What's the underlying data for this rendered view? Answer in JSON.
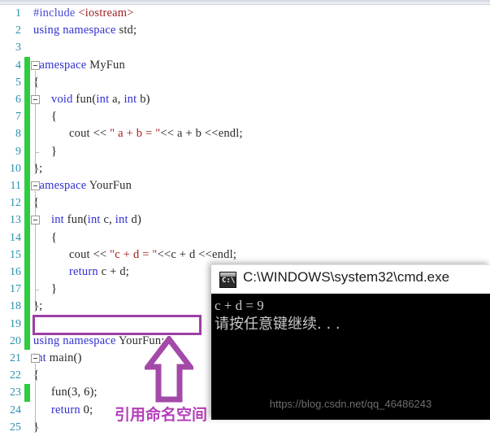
{
  "editor": {
    "first_line": 1,
    "lines": [
      {
        "n": 1,
        "changed": false,
        "indent": 0,
        "text": "#include <iostream>"
      },
      {
        "n": 2,
        "changed": false,
        "indent": 0,
        "text": "using namespace std;"
      },
      {
        "n": 3,
        "changed": false,
        "indent": 0,
        "text": ""
      },
      {
        "n": 4,
        "changed": true,
        "indent": 0,
        "text": "namespace MyFun"
      },
      {
        "n": 5,
        "changed": true,
        "indent": 0,
        "text": "{"
      },
      {
        "n": 6,
        "changed": true,
        "indent": 1,
        "text": "void  fun(int a,  int b)"
      },
      {
        "n": 7,
        "changed": true,
        "indent": 1,
        "text": "{"
      },
      {
        "n": 8,
        "changed": true,
        "indent": 2,
        "text": "cout << \" a + b = \"<< a + b <<endl;"
      },
      {
        "n": 9,
        "changed": true,
        "indent": 1,
        "text": "}"
      },
      {
        "n": 10,
        "changed": true,
        "indent": 0,
        "text": "};"
      },
      {
        "n": 11,
        "changed": true,
        "indent": 0,
        "text": "namespace YourFun"
      },
      {
        "n": 12,
        "changed": true,
        "indent": 0,
        "text": "{"
      },
      {
        "n": 13,
        "changed": true,
        "indent": 1,
        "text": "int fun(int c,  int d)"
      },
      {
        "n": 14,
        "changed": true,
        "indent": 1,
        "text": "{"
      },
      {
        "n": 15,
        "changed": true,
        "indent": 2,
        "text": "cout << \"c + d = \"<<c + d <<endl;"
      },
      {
        "n": 16,
        "changed": true,
        "indent": 2,
        "text": "return  c + d;"
      },
      {
        "n": 17,
        "changed": true,
        "indent": 1,
        "text": "}"
      },
      {
        "n": 18,
        "changed": true,
        "indent": 0,
        "text": "};"
      },
      {
        "n": 19,
        "changed": true,
        "indent": 0,
        "text": ""
      },
      {
        "n": 20,
        "changed": true,
        "indent": 0,
        "text": "using namespace YourFun;"
      },
      {
        "n": 21,
        "changed": false,
        "indent": 0,
        "text": "int main()"
      },
      {
        "n": 22,
        "changed": false,
        "indent": 0,
        "text": "{"
      },
      {
        "n": 23,
        "changed": true,
        "indent": 1,
        "text": "fun(3, 6);"
      },
      {
        "n": 24,
        "changed": false,
        "indent": 1,
        "text": "return 0;"
      },
      {
        "n": 25,
        "changed": false,
        "indent": 0,
        "text": "}"
      }
    ],
    "line_number_color": "#2b91af",
    "change_bar_color": "#2ecc40",
    "keyword_color": "#2f2fd0",
    "string_color": "#a21b1b",
    "preprocessor_color": "#4b4bd8",
    "header_color": "#9b2226",
    "background_color": "#ffffff"
  },
  "annotation": {
    "highlight_line": 20,
    "highlight_color": "#9c3fa4",
    "arrow_icon": "arrow-up-icon",
    "label": "引用命名空间",
    "label_color": "#b43fb8"
  },
  "console": {
    "icon": "cmd-icon",
    "icon_text": "C:\\",
    "title": "C:\\WINDOWS\\system32\\cmd.exe",
    "output_lines": [
      "c + d = 9",
      "请按任意键继续. . ."
    ],
    "background_color": "#000000",
    "text_color": "#c8c8c8"
  },
  "watermark": {
    "text": "https://blog.csdn.net/qq_46486243"
  }
}
